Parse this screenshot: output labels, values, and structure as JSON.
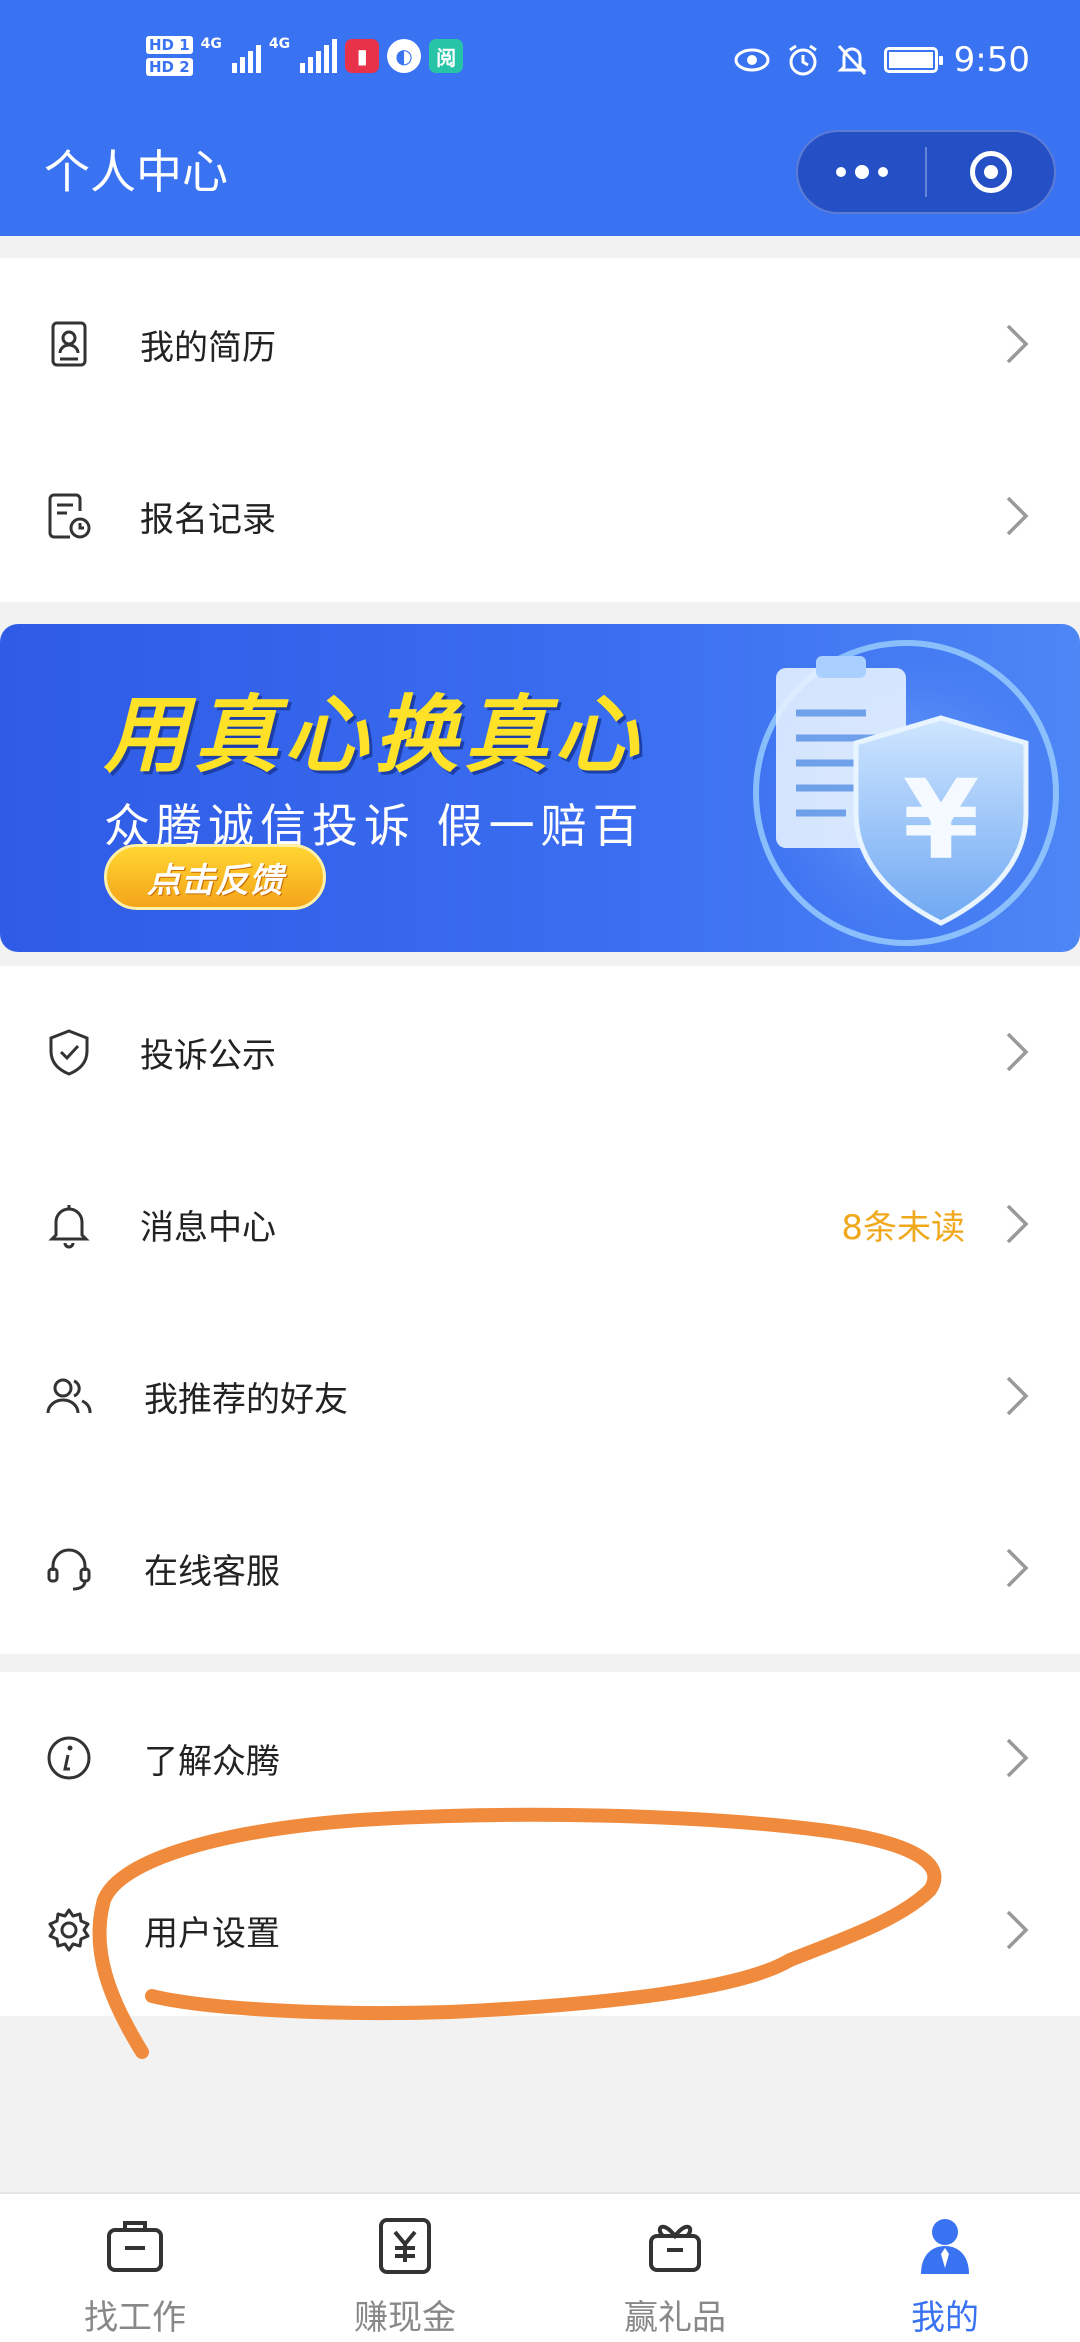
{
  "status_bar": {
    "hd1": "HD 1",
    "hd2": "HD 2",
    "net1": "4G",
    "net2": "4G",
    "app3_glyph": "阅",
    "time": "9:50"
  },
  "header": {
    "title": "个人中心"
  },
  "section1": [
    {
      "label": "我的简历",
      "icon": "resume-icon"
    },
    {
      "label": "报名记录",
      "icon": "record-icon"
    }
  ],
  "banner": {
    "title": "用真心换真心",
    "subtitle": "众腾诚信投诉 假一赔百",
    "button": "点击反馈",
    "art_symbol": "¥"
  },
  "section2": [
    {
      "label": "投诉公示",
      "icon": "shield-icon"
    },
    {
      "label": "消息中心",
      "icon": "bell-icon",
      "extra": "8条未读"
    },
    {
      "label": "我推荐的好友",
      "icon": "users-icon"
    },
    {
      "label": "在线客服",
      "icon": "headset-icon"
    }
  ],
  "section3": [
    {
      "label": "了解众腾",
      "icon": "info-icon"
    },
    {
      "label": "用户设置",
      "icon": "gear-icon"
    }
  ],
  "tabbar": [
    {
      "label": "找工作",
      "icon": "briefcase-icon",
      "active": false
    },
    {
      "label": "赚现金",
      "icon": "cash-icon",
      "active": false
    },
    {
      "label": "赢礼品",
      "icon": "gift-icon",
      "active": false
    },
    {
      "label": "我的",
      "icon": "person-icon",
      "active": true
    }
  ],
  "colors": {
    "header_bg": "#3a73f2",
    "accent": "#3a73f2",
    "unread": "#f0a81c",
    "annotation": "#f08a3c",
    "banner_title": "#ffe227"
  }
}
